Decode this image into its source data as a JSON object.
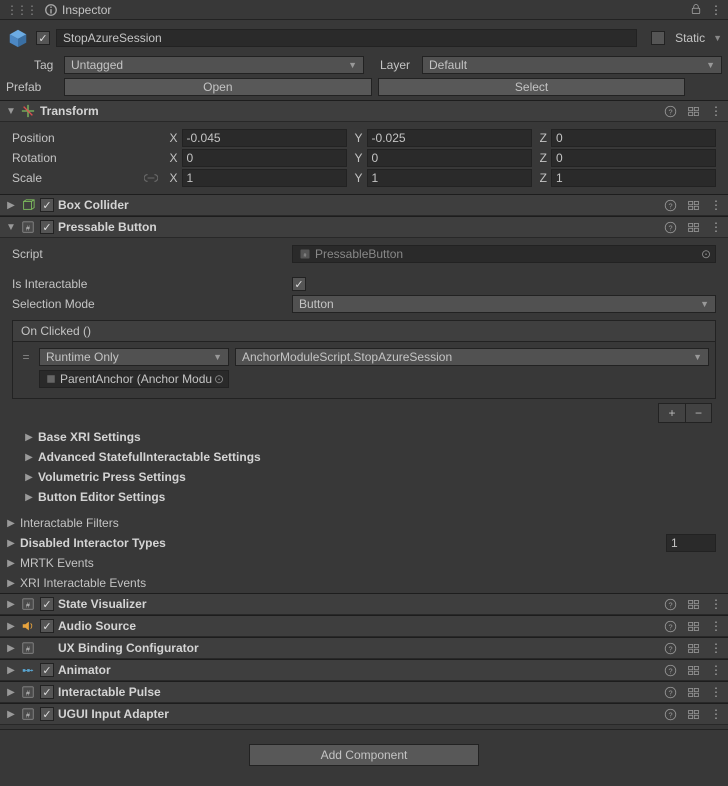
{
  "window": {
    "title": "Inspector"
  },
  "header": {
    "name": "StopAzureSession",
    "static_label": "Static",
    "tag_label": "Tag",
    "tag_value": "Untagged",
    "layer_label": "Layer",
    "layer_value": "Default",
    "prefab_label": "Prefab",
    "open_btn": "Open",
    "select_btn": "Select"
  },
  "transform": {
    "title": "Transform",
    "position_label": "Position",
    "rotation_label": "Rotation",
    "scale_label": "Scale",
    "x": "X",
    "y": "Y",
    "z": "Z",
    "pos": {
      "x": "-0.045",
      "y": "-0.025",
      "z": "0"
    },
    "rot": {
      "x": "0",
      "y": "0",
      "z": "0"
    },
    "scl": {
      "x": "1",
      "y": "1",
      "z": "1"
    }
  },
  "box_collider": {
    "title": "Box Collider"
  },
  "pressable": {
    "title": "Pressable Button",
    "script_label": "Script",
    "script_value": "PressableButton",
    "is_interactable_label": "Is Interactable",
    "selection_mode_label": "Selection Mode",
    "selection_mode_value": "Button",
    "event_title": "On Clicked ()",
    "runtime_only": "Runtime Only",
    "method": "AnchorModuleScript.StopAzureSession",
    "target": "ParentAnchor (Anchor Modu",
    "folds": {
      "base_xri": "Base XRI Settings",
      "advanced": "Advanced StatefulInteractable Settings",
      "volumetric": "Volumetric Press Settings",
      "button_editor": "Button Editor Settings"
    },
    "interactable_filters": "Interactable Filters",
    "disabled_types_label": "Disabled Interactor Types",
    "disabled_types_value": "1",
    "mrtk_events": "MRTK Events",
    "xri_events": "XRI Interactable Events"
  },
  "components": {
    "state_visualizer": "State Visualizer",
    "audio_source": "Audio Source",
    "ux_binding": "UX Binding Configurator",
    "animator": "Animator",
    "interactable_pulse": "Interactable Pulse",
    "ugui_adapter": "UGUI Input Adapter"
  },
  "add_component": "Add Component"
}
